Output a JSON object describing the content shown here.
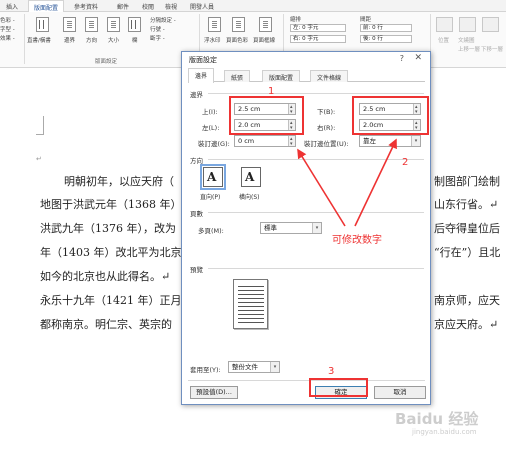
{
  "ribbon": {
    "tabs": [
      "插入",
      "版面配置",
      "參考資料",
      "郵件",
      "校閱",
      "檢視",
      "開發人員"
    ],
    "active_tab_index": 1,
    "left_cut": [
      "色彩 -",
      "字型 -",
      "效果 -"
    ],
    "buttons": [
      "直書/橫書",
      "邊界",
      "方向",
      "大小",
      "欄"
    ],
    "small_items": [
      "分隔設定 -",
      "行號 -",
      "斷字 -"
    ],
    "page_bg_buttons": [
      "浮水印",
      "頁面色彩",
      "頁面框線"
    ],
    "indent_label": "縮排",
    "indent_left": "左: 0 字元",
    "indent_right": "右: 0 字元",
    "spacing_label": "間距",
    "spacing_before": "前: 0 行",
    "spacing_after": "後: 0 行",
    "arrange_items": [
      "位置",
      "文繞圖",
      "上移一層",
      "下移一層"
    ],
    "group_label": "版面設定"
  },
  "document": {
    "para_mark": "↵",
    "lines": [
      "明朝初年，以应天府（",
      "地图于洪武元年（1368 年）",
      "洪武九年（1376 年），改为",
      "年（1403 年）改北平为北京",
      "如今的北京也从此得名。↵",
      "永乐十九年（1421 年）正月",
      "都称南京。明仁宗、英宗的"
    ],
    "right_lines": [
      "制图部门绘制",
      "山东行省。↵",
      "后夺得皇位后",
      "“行在”）且北",
      "",
      "南京师，应天",
      "京应天府。↵"
    ]
  },
  "dialog": {
    "title": "版面設定",
    "help": "?",
    "close": "✕",
    "tabs": [
      "邊界",
      "紙張",
      "版面配置",
      "文件格線"
    ],
    "active_tab": 0,
    "margins_section": "邊界",
    "top_label": "上(I):",
    "top_value": "2.5 cm",
    "bottom_label": "下(B):",
    "bottom_value": "2.5 cm",
    "left_label": "左(L):",
    "left_value": "2.0 cm",
    "right_label": "右(R):",
    "right_value": "2.0cm",
    "gutter_label": "裝訂邊(G):",
    "gutter_value": "0 cm",
    "gutter_pos_label": "裝訂邊位置(U):",
    "gutter_pos_value": "靠左",
    "orientation_section": "方向",
    "portrait_label": "直向(P)",
    "landscape_label": "橫向(S)",
    "pages_section": "頁數",
    "multiple_pages_label": "多頁(M):",
    "multiple_pages_value": "標準",
    "preview_section": "預覽",
    "apply_to_label": "套用至(Y):",
    "apply_to_value": "整份文件",
    "set_default_button": "預設值(D)...",
    "ok_button": "確定",
    "cancel_button": "取消"
  },
  "annotations": {
    "n1": "1",
    "n2": "2",
    "n3": "3",
    "modify_note": "可修改数字",
    "color": "#e33333"
  },
  "watermark": {
    "brand": "Baidu 经验",
    "url": "jingyan.baidu.com"
  }
}
